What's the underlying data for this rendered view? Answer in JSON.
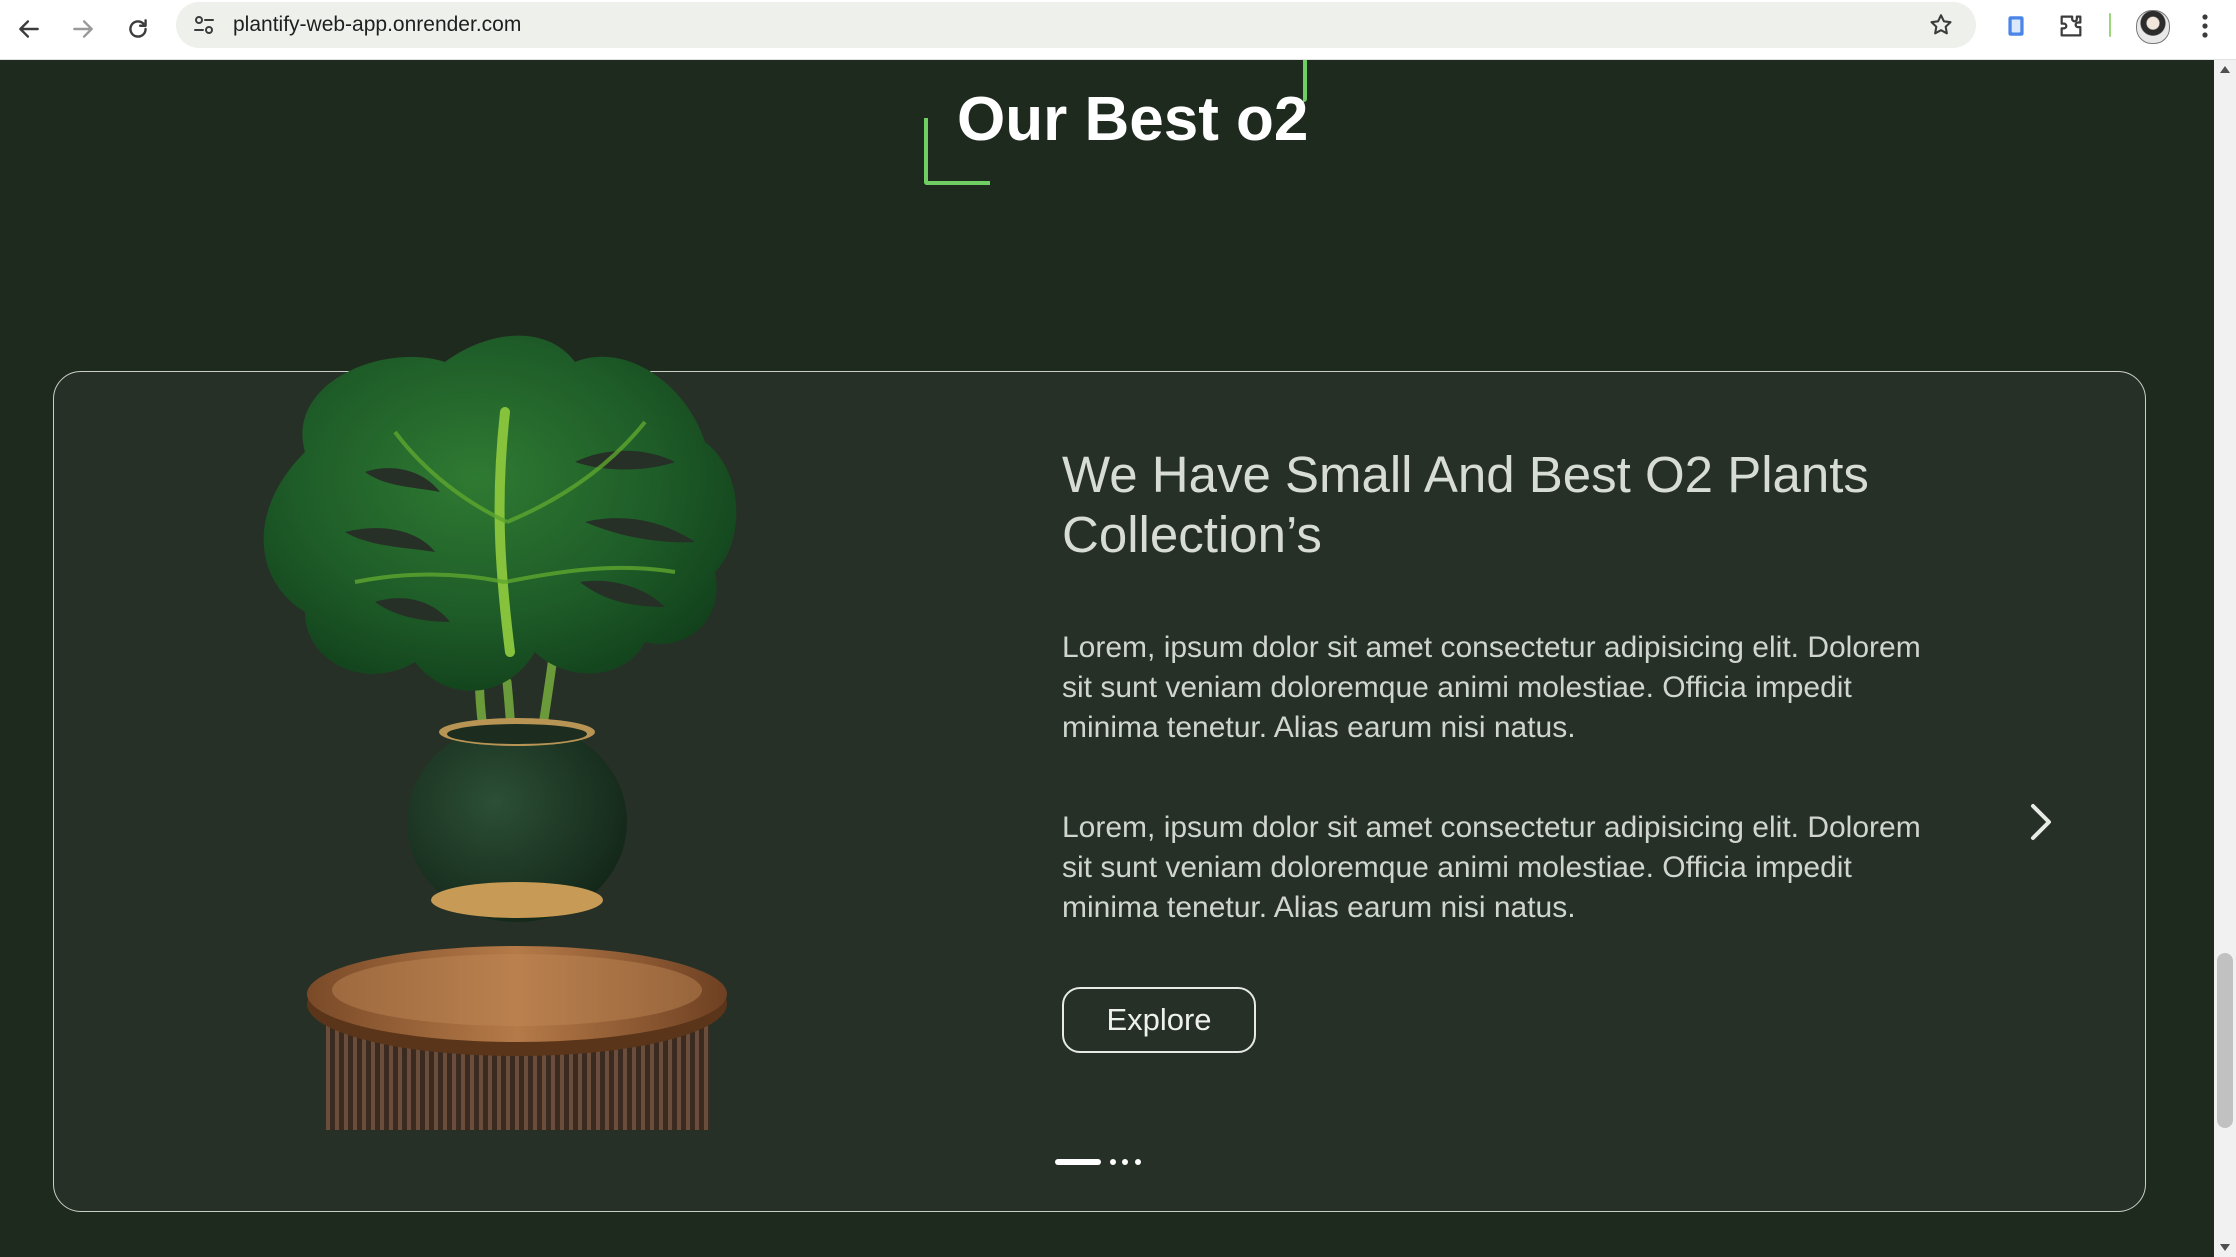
{
  "browser": {
    "url": "plantify-web-app.onrender.com",
    "icons": {
      "back": "back-arrow-icon",
      "forward": "forward-arrow-icon",
      "reload": "reload-icon",
      "site_info": "site-settings-icon",
      "bookmark": "star-icon",
      "extension_a": "app-extension-icon",
      "extensions": "puzzle-icon",
      "profile": "profile-avatar",
      "menu": "kebab-menu-icon"
    }
  },
  "section": {
    "title": "Our Best o2",
    "accent_color": "#6fcf63",
    "background_color": "#1f2a1f"
  },
  "slide": {
    "heading": "We Have Small And Best O2 Plants Collection’s",
    "paragraph_1": "Lorem, ipsum dolor sit amet consectetur adipisicing elit. Dolorem sit sunt veniam doloremque animi molestiae. Officia impedit minima tenetur. Alias earum nisi natus.",
    "paragraph_2": "Lorem, ipsum dolor sit amet consectetur adipisicing elit. Dolorem sit sunt veniam doloremque animi molestiae. Officia impedit minima tenetur. Alias earum nisi natus.",
    "button_label": "Explore",
    "image": "monstera-plant-in-pot-on-wooden-stand",
    "next_icon": "chevron-right-icon"
  },
  "carousel": {
    "slide_count": 4,
    "active_index": 0
  }
}
